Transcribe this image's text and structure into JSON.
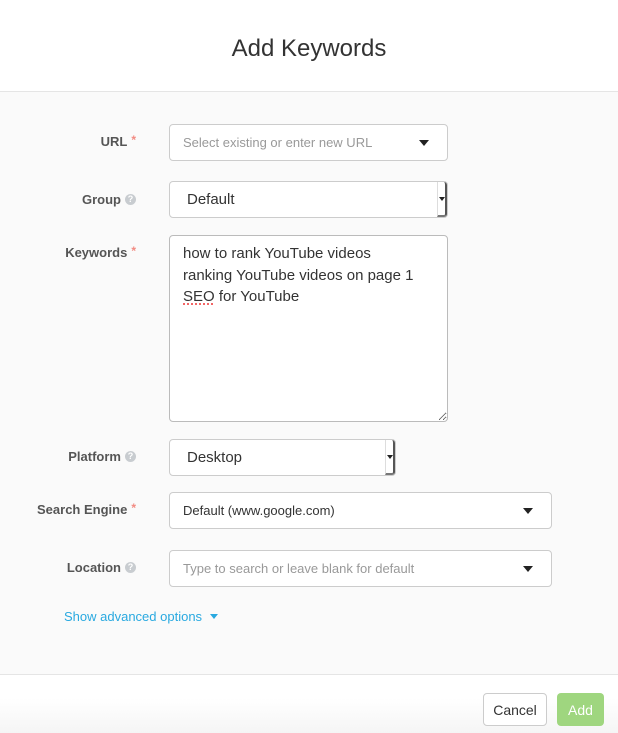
{
  "dialog": {
    "title": "Add Keywords"
  },
  "form": {
    "url": {
      "label": "URL",
      "required_mark": "*",
      "placeholder": "Select existing or enter new URL"
    },
    "group": {
      "label": "Group",
      "help_icon": "?",
      "value": "Default"
    },
    "keywords": {
      "label": "Keywords",
      "required_mark": "*",
      "lines": [
        "how to rank YouTube videos",
        "ranking YouTube videos on page 1",
        "SEO for YouTube"
      ],
      "misspelled_word": "SEO",
      "line3_rest": " for YouTube"
    },
    "platform": {
      "label": "Platform",
      "help_icon": "?",
      "value": "Desktop"
    },
    "search_engine": {
      "label": "Search Engine",
      "required_mark": "*",
      "value": "Default (www.google.com)"
    },
    "location": {
      "label": "Location",
      "help_icon": "?",
      "placeholder": "Type to search or leave blank for default"
    },
    "advanced_link": "Show advanced options"
  },
  "footer": {
    "cancel_label": "Cancel",
    "add_label": "Add"
  },
  "colors": {
    "accent_link": "#29a9e0",
    "add_button": "#9fd67f",
    "required": "#f28b82"
  }
}
